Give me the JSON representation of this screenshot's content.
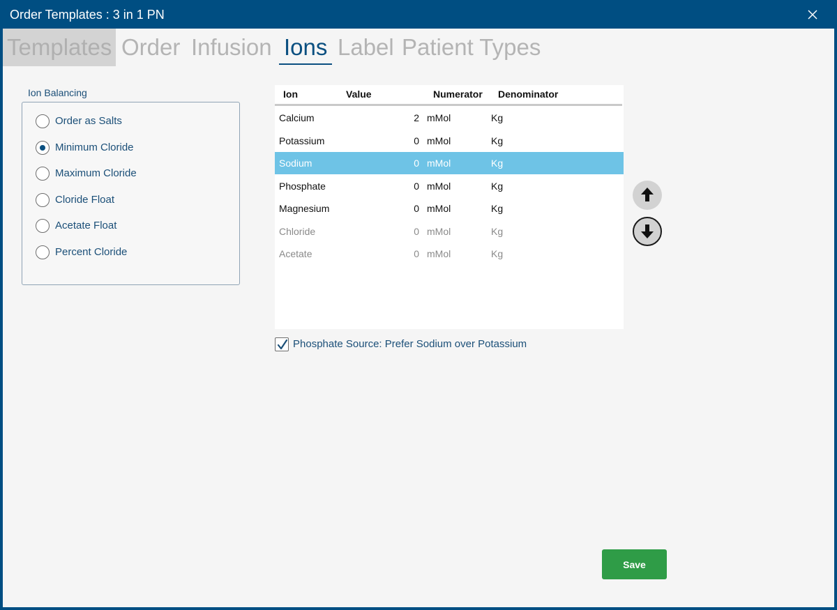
{
  "window": {
    "title": "Order Templates : 3 in 1 PN"
  },
  "tabs": [
    {
      "label": "Templates"
    },
    {
      "label": "Order"
    },
    {
      "label": "Infusion"
    },
    {
      "label": "Ions"
    },
    {
      "label": "Label"
    },
    {
      "label": "Patient Types"
    }
  ],
  "active_tab": "Ions",
  "ion_balancing": {
    "label": "Ion Balancing",
    "selected": "Minimum Cloride",
    "options": [
      {
        "label": "Order as Salts"
      },
      {
        "label": "Minimum Cloride"
      },
      {
        "label": "Maximum Cloride"
      },
      {
        "label": "Cloride Float"
      },
      {
        "label": "Acetate Float"
      },
      {
        "label": "Percent Cloride"
      }
    ]
  },
  "ion_grid": {
    "columns": {
      "ion": "Ion",
      "value": "Value",
      "numerator": "Numerator",
      "denominator": "Denominator"
    },
    "selected_row": "Sodium",
    "rows": [
      {
        "ion": "Calcium",
        "value": "2",
        "numerator": "mMol",
        "denominator": "Kg"
      },
      {
        "ion": "Potassium",
        "value": "0",
        "numerator": "mMol",
        "denominator": "Kg"
      },
      {
        "ion": "Sodium",
        "value": "0",
        "numerator": "mMol",
        "denominator": "Kg"
      },
      {
        "ion": "Phosphate",
        "value": "0",
        "numerator": "mMol",
        "denominator": "Kg"
      },
      {
        "ion": "Magnesium",
        "value": "0",
        "numerator": "mMol",
        "denominator": "Kg"
      },
      {
        "ion": "Chloride",
        "value": "0",
        "numerator": "mMol",
        "denominator": "Kg"
      },
      {
        "ion": "Acetate",
        "value": "0",
        "numerator": "mMol",
        "denominator": "Kg"
      }
    ]
  },
  "phosphate_source": {
    "label": "Phosphate Source: Prefer Sodium over Potassium",
    "checked": true
  },
  "save_label": "Save",
  "colors": {
    "title_bar": "#004e82",
    "accent": "#0a4f80",
    "selected_row": "#6ec3e6",
    "save_button": "#2f9c47"
  }
}
